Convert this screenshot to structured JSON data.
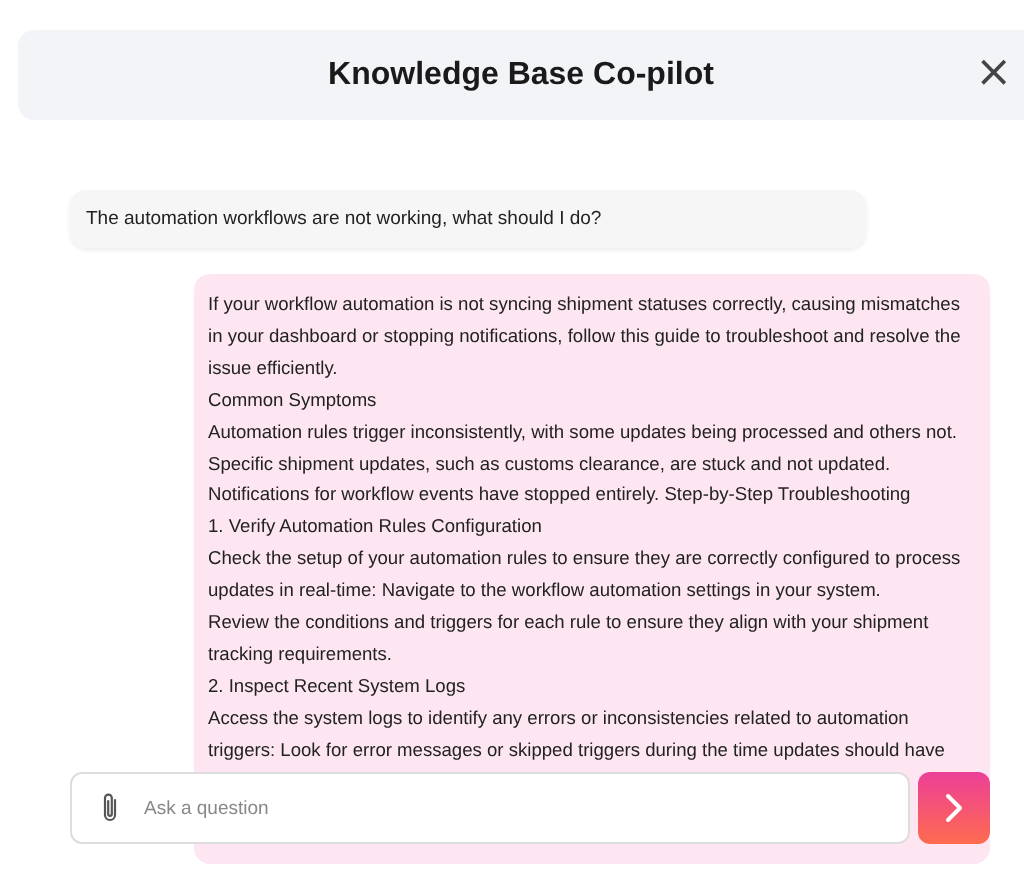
{
  "header": {
    "title": "Knowledge Base Co-pilot",
    "close_icon": "×"
  },
  "messages": [
    {
      "kind": "user",
      "paragraphs": [
        "The automation workflows are not working, what should I do?"
      ]
    },
    {
      "kind": "assistant",
      "paragraphs": [
        "If your workflow automation is not syncing shipment statuses correctly, causing mismatches in your dashboard or stopping notifications, follow this guide to troubleshoot and resolve the issue efficiently.",
        "Common Symptoms",
        "Automation rules trigger inconsistently, with some updates being processed and others not.",
        "Specific shipment updates, such as customs clearance, are stuck and not updated.",
        "Notifications for workflow events have stopped entirely. Step-by-Step Troubleshooting",
        "1. Verify Automation Rules Configuration",
        "Check the setup of your automation rules to ensure they are correctly configured to process updates in real-time: Navigate to the workflow automation settings in your system.",
        "Review the conditions and triggers for each rule to ensure they align with your shipment tracking requirements.",
        "2. Inspect Recent System Logs",
        "Access the system logs to identify any errors or inconsistencies related to automation triggers: Look for error messages or skipped triggers during the time updates should have"
      ]
    }
  ],
  "composer": {
    "placeholder": "Ask a question"
  }
}
